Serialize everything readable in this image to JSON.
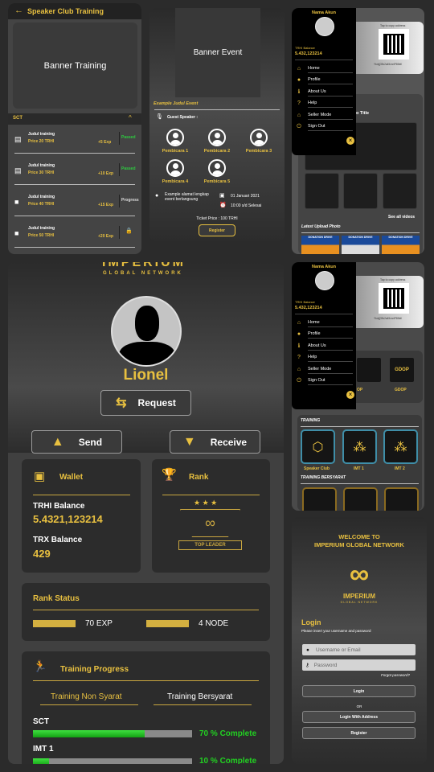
{
  "training_screen": {
    "title": "Speaker Club Training",
    "banner": "Banner Training",
    "section": "SCT",
    "items": [
      {
        "title": "Judul training",
        "price": "Price 20 TRHI",
        "exp": "+5 Exp",
        "status": "Passed",
        "icon": "pdf-icon"
      },
      {
        "title": "Judul training",
        "price": "Price 30 TRHI",
        "exp": "+10 Exp",
        "status": "Passed",
        "icon": "pdf-icon"
      },
      {
        "title": "Judul training",
        "price": "Price 40 TRHI",
        "exp": "+15 Exp",
        "status": "Progress",
        "icon": "video-icon"
      },
      {
        "title": "Judul training",
        "price": "Price 50 TRHI",
        "exp": "+20 Exp",
        "status": "",
        "icon": "video-icon"
      }
    ]
  },
  "event_screen": {
    "banner": "Banner Event",
    "title": "Example Judul Event",
    "guest_label": "Guest Speaker :",
    "speakers": [
      "Pembicara 1",
      "Pembicara 2",
      "Pembicara 3",
      "Pembicara 4",
      "Pembicara 5"
    ],
    "address": "Example alamat lengkap event berlangsung",
    "date": "01 Januari 2021",
    "time": "10:00 s/d Selesai",
    "ticket": "Ticket Price : 100  TRHI",
    "register": "Register"
  },
  "drawer": {
    "account_name": "Nama Akun",
    "balance_label": "TRHI Balance",
    "balance": "5.432,123214",
    "items": [
      "Home",
      "Profile",
      "About Us",
      "Help",
      "Seller Mode",
      "Sign Out"
    ]
  },
  "home_screen": {
    "copy_hint": "Tap to copy address",
    "address": "Ykdy[39c2a45xnnP5l8ell",
    "video_title": "o Title",
    "see_all": "See all videos",
    "photos_label": "Latest Upload Photo",
    "photo_text": "DONATION DRIVE"
  },
  "home_screen2": {
    "tiles": [
      "OP",
      "GDOP"
    ],
    "tile_text": "GDOP",
    "tab": "TRAINING",
    "training_label": "TRAINING",
    "training": [
      "Speaker Club",
      "IMT 1",
      "IMT 2"
    ],
    "bersyarat_label": "TRAINING BERSYARAT"
  },
  "profile": {
    "brand": "IMPERIUM",
    "brand_sub": "GLOBAL NETWORK",
    "name": "Lionel",
    "request": "Request",
    "send": "Send",
    "receive": "Receive",
    "wallet_label": "Wallet",
    "trhi_label": "TRHI Balance",
    "trhi_value": "5.4321,123214",
    "trx_label": "TRX Balance",
    "trx_value": "429",
    "rank_label": "Rank",
    "rank_badge": "TOP LEADER",
    "rank_status_label": "Rank Status",
    "exp": "70 EXP",
    "node": "4 NODE",
    "training_label": "Training Progress",
    "tab_non": "Training Non Syarat",
    "tab_syarat": "Training Bersyarat",
    "progress": [
      {
        "name": "SCT",
        "percent": 70,
        "label": "70 % Complete"
      },
      {
        "name": "IMT 1",
        "percent": 10,
        "label": "10 % Complete"
      }
    ]
  },
  "login": {
    "welcome1": "WELCOME TO",
    "welcome2": "IMPERIUM GLOBAL NETWORK",
    "brand": "IMPERIUM",
    "brand_sub": "GLOBAL NETWORK",
    "title": "Login",
    "subtitle": "Please insert your username and password",
    "username_placeholder": "Username or Email",
    "password_placeholder": "Password",
    "forgot": "Forgot password?",
    "login": "Login",
    "or": "OR",
    "login_address": "Login With Address",
    "register": "Register"
  },
  "colors": {
    "accent": "#e8c040",
    "passed": "#2ecc40",
    "progress": "#22c022",
    "tile_border": "#3f8ea8"
  }
}
